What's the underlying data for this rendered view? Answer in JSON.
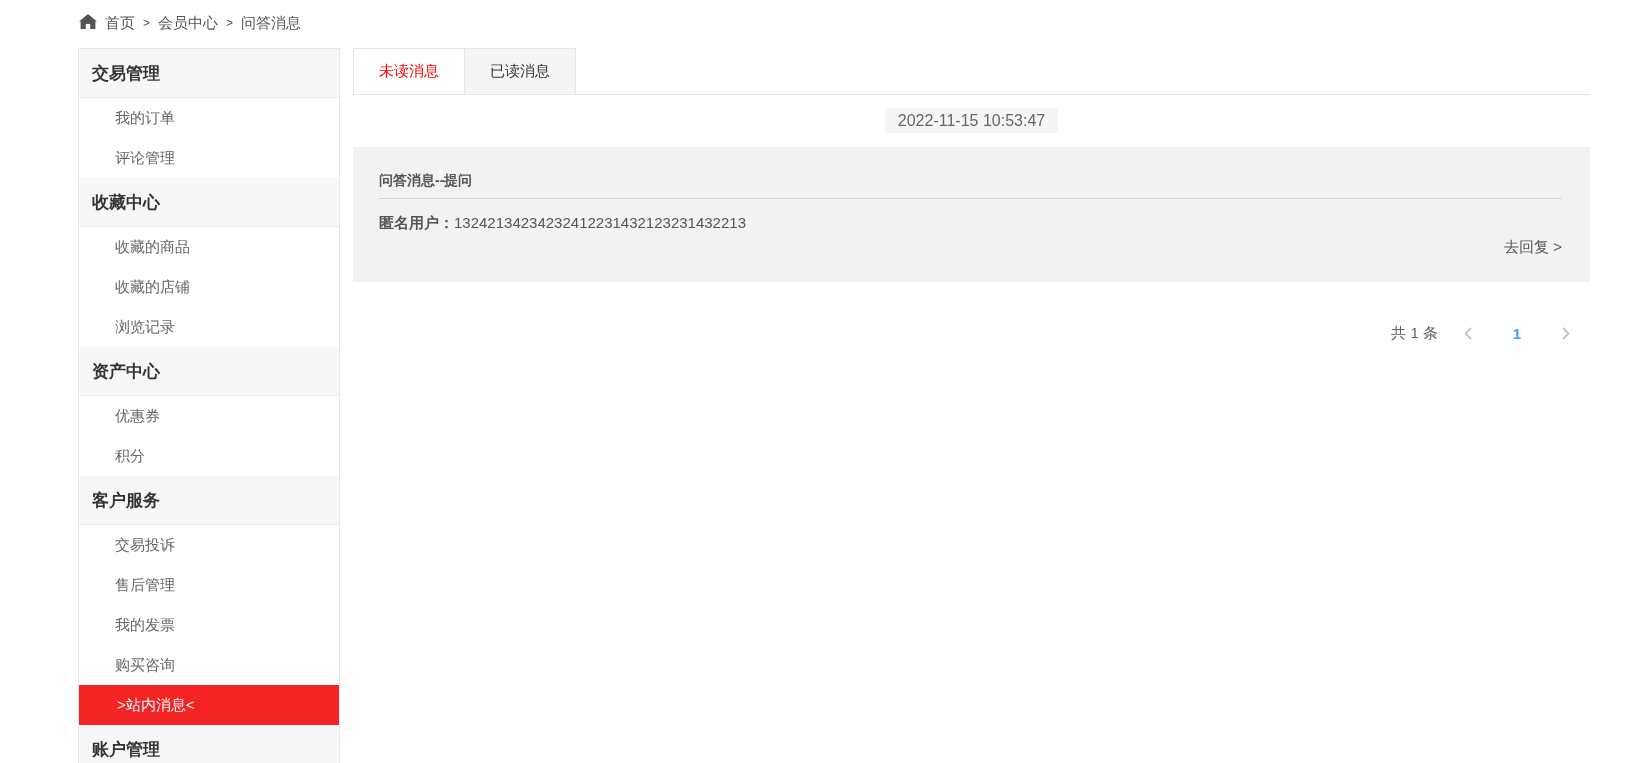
{
  "breadcrumb": [
    {
      "kind": "link",
      "text": "首页"
    },
    {
      "kind": "separator",
      "text": ">"
    },
    {
      "kind": "link",
      "text": "会员中心"
    },
    {
      "kind": "separator",
      "text": ">"
    },
    {
      "kind": "link",
      "text": "问答消息"
    }
  ],
  "sidebar": {
    "groups": [
      {
        "title": "交易管理",
        "items": [
          {
            "label": "我的订单",
            "selected": false
          },
          {
            "label": "评论管理",
            "selected": false
          }
        ]
      },
      {
        "title": "收藏中心",
        "items": [
          {
            "label": "收藏的商品",
            "selected": false
          },
          {
            "label": "收藏的店铺",
            "selected": false
          },
          {
            "label": "浏览记录",
            "selected": false
          }
        ]
      },
      {
        "title": "资产中心",
        "items": [
          {
            "label": "优惠券",
            "selected": false
          },
          {
            "label": "积分",
            "selected": false
          }
        ]
      },
      {
        "title": "客户服务",
        "items": [
          {
            "label": "交易投诉",
            "selected": false
          },
          {
            "label": "售后管理",
            "selected": false
          },
          {
            "label": "我的发票",
            "selected": false
          },
          {
            "label": "购买咨询",
            "selected": false
          },
          {
            "label": ">站内消息<",
            "selected": true
          }
        ]
      },
      {
        "title": "账户管理"
      }
    ]
  },
  "tabs": [
    {
      "label": "未读消息",
      "selected": true
    },
    {
      "label": "已读消息",
      "selected": false
    }
  ],
  "messages": [
    {
      "time": "2022-11-15 10:53:47",
      "title": "问答消息--提问",
      "sender": "**匿名用户：**13242134234232412231432123231432213",
      "reply": "去回复 >"
    }
  ],
  "pagination": {
    "total": "共 1 条",
    "prev": {
      "disabled": true
    },
    "pages": [
      {
        "label": "1",
        "selected": true
      }
    ],
    "next": {
      "disabled": true
    }
  }
}
